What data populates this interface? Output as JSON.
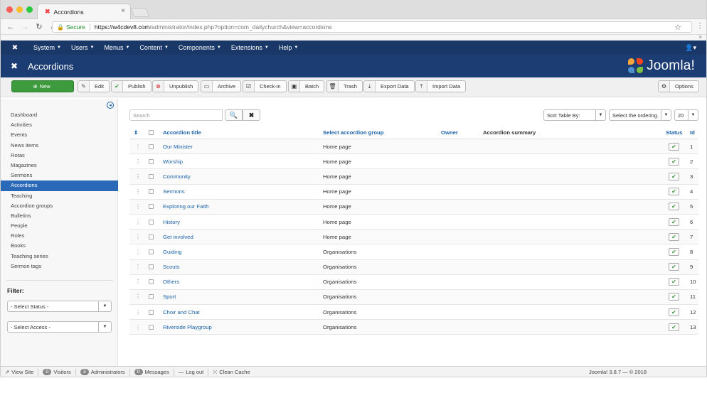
{
  "browser": {
    "tab_title": "Accordions",
    "tab_close": "×",
    "secure_label": "Secure",
    "url_host": "https://w4cdev8.com",
    "url_path": "/administrator/index.php?option=com_dailychurch&view=accordions",
    "ext_chevron": "»",
    "colors": {
      "close": "#fc5f57",
      "minimize": "#fdbc2e",
      "maximize": "#29c940"
    }
  },
  "nav": {
    "items": [
      {
        "label": "System"
      },
      {
        "label": "Users"
      },
      {
        "label": "Menus"
      },
      {
        "label": "Content"
      },
      {
        "label": "Components"
      },
      {
        "label": "Extensions"
      },
      {
        "label": "Help"
      }
    ]
  },
  "header": {
    "title": "Accordions",
    "brand": "Joomla!"
  },
  "toolbar": {
    "new": "New",
    "edit": "Edit",
    "publish": "Publish",
    "unpublish": "Unpublish",
    "archive": "Archive",
    "checkin": "Check-in",
    "batch": "Batch",
    "trash": "Trash",
    "export": "Export Data",
    "import": "Import Data",
    "options": "Options"
  },
  "sidebar": {
    "items": [
      {
        "label": "Dashboard"
      },
      {
        "label": "Activities"
      },
      {
        "label": "Events"
      },
      {
        "label": "News items"
      },
      {
        "label": "Rotas"
      },
      {
        "label": "Magazines"
      },
      {
        "label": "Sermons"
      },
      {
        "label": "Accordions"
      },
      {
        "label": "Teaching"
      },
      {
        "label": "Accordion groups"
      },
      {
        "label": "Bulletins"
      },
      {
        "label": "People"
      },
      {
        "label": "Roles"
      },
      {
        "label": "Books"
      },
      {
        "label": "Teaching series"
      },
      {
        "label": "Sermon tags"
      }
    ],
    "active_index": 7,
    "filter_label": "Filter:",
    "status_select": "- Select Status -",
    "access_select": "- Select Access -"
  },
  "search": {
    "placeholder": "Search",
    "sort_label": "Sort Table By:",
    "ordering_label": "Select the ordering.",
    "limit": "20"
  },
  "table": {
    "columns": {
      "title": "Accordion title",
      "group": "Select accordion group",
      "owner": "Owner",
      "summary": "Accordion summary",
      "status": "Status",
      "id": "Id"
    },
    "rows": [
      {
        "title": "Our Minister",
        "group": "Home page",
        "id": "1"
      },
      {
        "title": "Worship",
        "group": "Home page",
        "id": "2"
      },
      {
        "title": "Community",
        "group": "Home page",
        "id": "3"
      },
      {
        "title": "Sermons",
        "group": "Home page",
        "id": "4"
      },
      {
        "title": "Exploring our Faith",
        "group": "Home page",
        "id": "5"
      },
      {
        "title": "History",
        "group": "Home page",
        "id": "6"
      },
      {
        "title": "Get involved",
        "group": "Home page",
        "id": "7"
      },
      {
        "title": "Guiding",
        "group": "Organisations",
        "id": "8"
      },
      {
        "title": "Scouts",
        "group": "Organisations",
        "id": "9"
      },
      {
        "title": "Others",
        "group": "Organisations",
        "id": "10"
      },
      {
        "title": "Sport",
        "group": "Organisations",
        "id": "11"
      },
      {
        "title": "Choir and Chat",
        "group": "Organisations",
        "id": "12"
      },
      {
        "title": "Riverside Playgroup",
        "group": "Organisations",
        "id": "13"
      }
    ]
  },
  "footer": {
    "view_site": "View Site",
    "visitors_count": "0",
    "visitors": "Visitors",
    "admins_count": "3",
    "admins": "Administrators",
    "messages_count": "0",
    "messages": "Messages",
    "logout": "Log out",
    "clean_cache": "Clean Cache",
    "version": "Joomla! 3.8.7  —  © 2018"
  }
}
